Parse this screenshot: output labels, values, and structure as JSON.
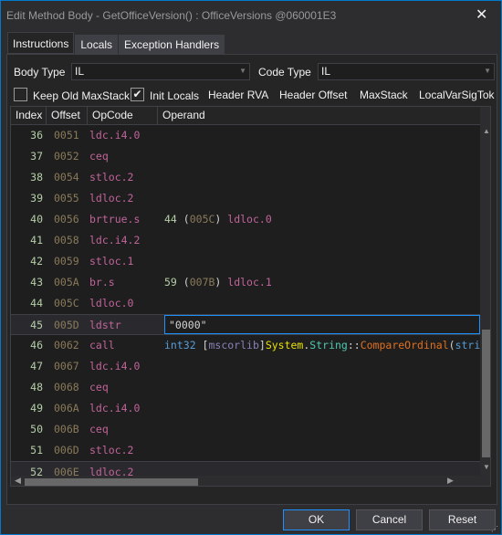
{
  "window": {
    "title": "Edit Method Body - GetOfficeVersion() : OfficeVersions @060001E3",
    "close_icon": "close-icon"
  },
  "tabs": [
    {
      "label": "Instructions",
      "active": true
    },
    {
      "label": "Locals"
    },
    {
      "label": "Exception Handlers"
    }
  ],
  "body_type": {
    "label": "Body Type",
    "value": "IL"
  },
  "code_type": {
    "label": "Code Type",
    "value": "IL"
  },
  "options": {
    "keep_old_maxstack": {
      "label": "Keep Old MaxStack",
      "checked": false
    },
    "init_locals": {
      "label": "Init Locals",
      "checked": true
    },
    "header_rva": "Header RVA",
    "header_offset": "Header Offset",
    "maxstack": "MaxStack",
    "localvarsigtok": "LocalVarSigTok"
  },
  "columns": [
    "Index",
    "Offset",
    "OpCode",
    "Operand"
  ],
  "rows": [
    {
      "index": "36",
      "offset": "0051",
      "opcode": "ldc.i4.0",
      "operand": []
    },
    {
      "index": "37",
      "offset": "0052",
      "opcode": "ceq",
      "operand": []
    },
    {
      "index": "38",
      "offset": "0054",
      "opcode": "stloc.2",
      "operand": []
    },
    {
      "index": "39",
      "offset": "0055",
      "opcode": "ldloc.2",
      "operand": []
    },
    {
      "index": "40",
      "offset": "0056",
      "opcode": "brtrue.s",
      "operand": [
        {
          "t": "44 ",
          "c": "#b5cea8"
        },
        {
          "t": "(",
          "c": "#d4d4d4"
        },
        {
          "t": "005C",
          "c": "#8a7a5a"
        },
        {
          "t": ") ",
          "c": "#d4d4d4"
        },
        {
          "t": "ldloc.0",
          "c": "#c0649a"
        }
      ]
    },
    {
      "index": "41",
      "offset": "0058",
      "opcode": "ldc.i4.2",
      "operand": []
    },
    {
      "index": "42",
      "offset": "0059",
      "opcode": "stloc.1",
      "operand": []
    },
    {
      "index": "43",
      "offset": "005A",
      "opcode": "br.s",
      "operand": [
        {
          "t": "59 ",
          "c": "#b5cea8"
        },
        {
          "t": "(",
          "c": "#d4d4d4"
        },
        {
          "t": "007B",
          "c": "#8a7a5a"
        },
        {
          "t": ") ",
          "c": "#d4d4d4"
        },
        {
          "t": "ldloc.1",
          "c": "#c0649a"
        }
      ]
    },
    {
      "index": "44",
      "offset": "005C",
      "opcode": "ldloc.0",
      "operand": []
    },
    {
      "index": "45",
      "offset": "005D",
      "opcode": "ldstr",
      "operand": [
        {
          "t": "\"0000\"",
          "c": "#d4d4d4"
        }
      ],
      "editing": true
    },
    {
      "index": "46",
      "offset": "0062",
      "opcode": "call",
      "operand": [
        {
          "t": "int32 ",
          "c": "#569cd6"
        },
        {
          "t": "[",
          "c": "#d4d4d4"
        },
        {
          "t": "mscorlib",
          "c": "#8a80b8"
        },
        {
          "t": "]",
          "c": "#d4d4d4"
        },
        {
          "t": "System",
          "c": "#e8e000"
        },
        {
          "t": ".",
          "c": "#d4d4d4"
        },
        {
          "t": "String",
          "c": "#4ec9b0"
        },
        {
          "t": "::",
          "c": "#d4d4d4"
        },
        {
          "t": "CompareOrdinal",
          "c": "#e07020"
        },
        {
          "t": "(",
          "c": "#d4d4d4"
        },
        {
          "t": "stri",
          "c": "#569cd6"
        }
      ]
    },
    {
      "index": "47",
      "offset": "0067",
      "opcode": "ldc.i4.0",
      "operand": []
    },
    {
      "index": "48",
      "offset": "0068",
      "opcode": "ceq",
      "operand": []
    },
    {
      "index": "49",
      "offset": "006A",
      "opcode": "ldc.i4.0",
      "operand": []
    },
    {
      "index": "50",
      "offset": "006B",
      "opcode": "ceq",
      "operand": []
    },
    {
      "index": "51",
      "offset": "006D",
      "opcode": "stloc.2",
      "operand": []
    },
    {
      "index": "52",
      "offset": "006E",
      "opcode": "ldloc.2",
      "operand": [],
      "selected": true
    }
  ],
  "buttons": {
    "ok": "OK",
    "cancel": "Cancel",
    "reset": "Reset"
  }
}
